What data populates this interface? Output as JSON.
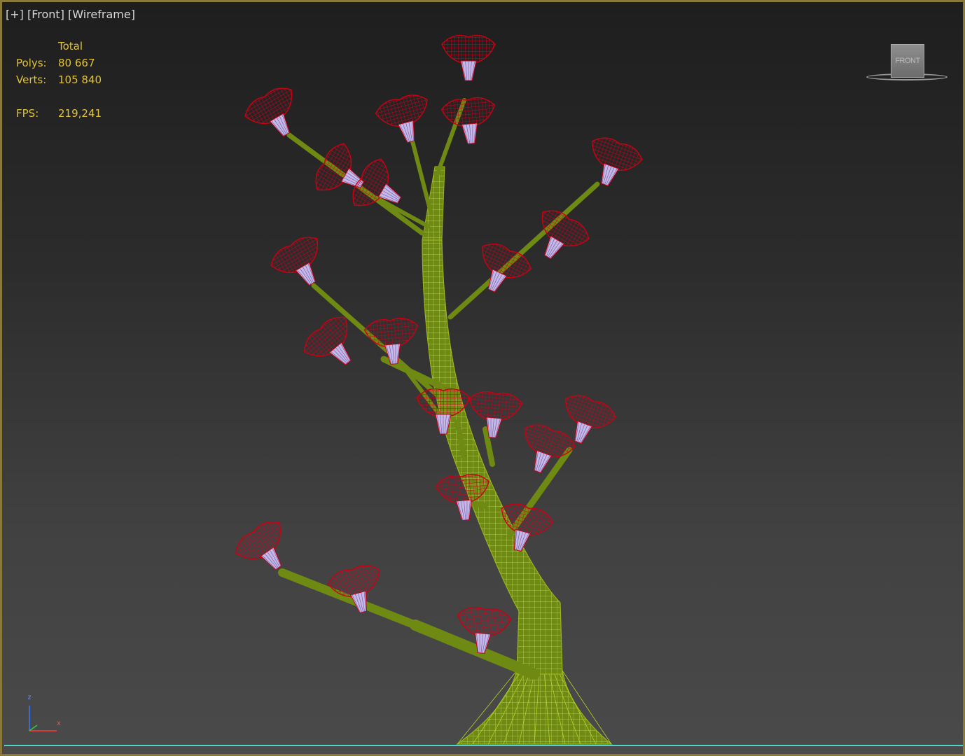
{
  "viewport": {
    "menu_plus": "[+]",
    "menu_view": "[Front]",
    "menu_shading": "[Wireframe]"
  },
  "stats": {
    "header": "Total",
    "polys_label": "Polys:",
    "polys_value": "80 667",
    "verts_label": "Verts:",
    "verts_value": "105 840",
    "fps_label": "FPS:",
    "fps_value": "219,241"
  },
  "viewcube": {
    "face_label": "FRONT"
  },
  "axis_gizmo": {
    "z_label": "z",
    "x_label": "x"
  },
  "colors": {
    "stats_text": "#e0c23a",
    "menu_text": "#d8d8d8",
    "border": "#8a7a3a",
    "stem_wire": "#9ab51a",
    "branch_fill": "#6f8a12",
    "flower_wire": "#cc0011",
    "flower_inner": "#c7b8e8",
    "ground_line": "#4fd3c8"
  },
  "icons": [
    "viewcube-icon",
    "axis-gizmo-icon"
  ]
}
